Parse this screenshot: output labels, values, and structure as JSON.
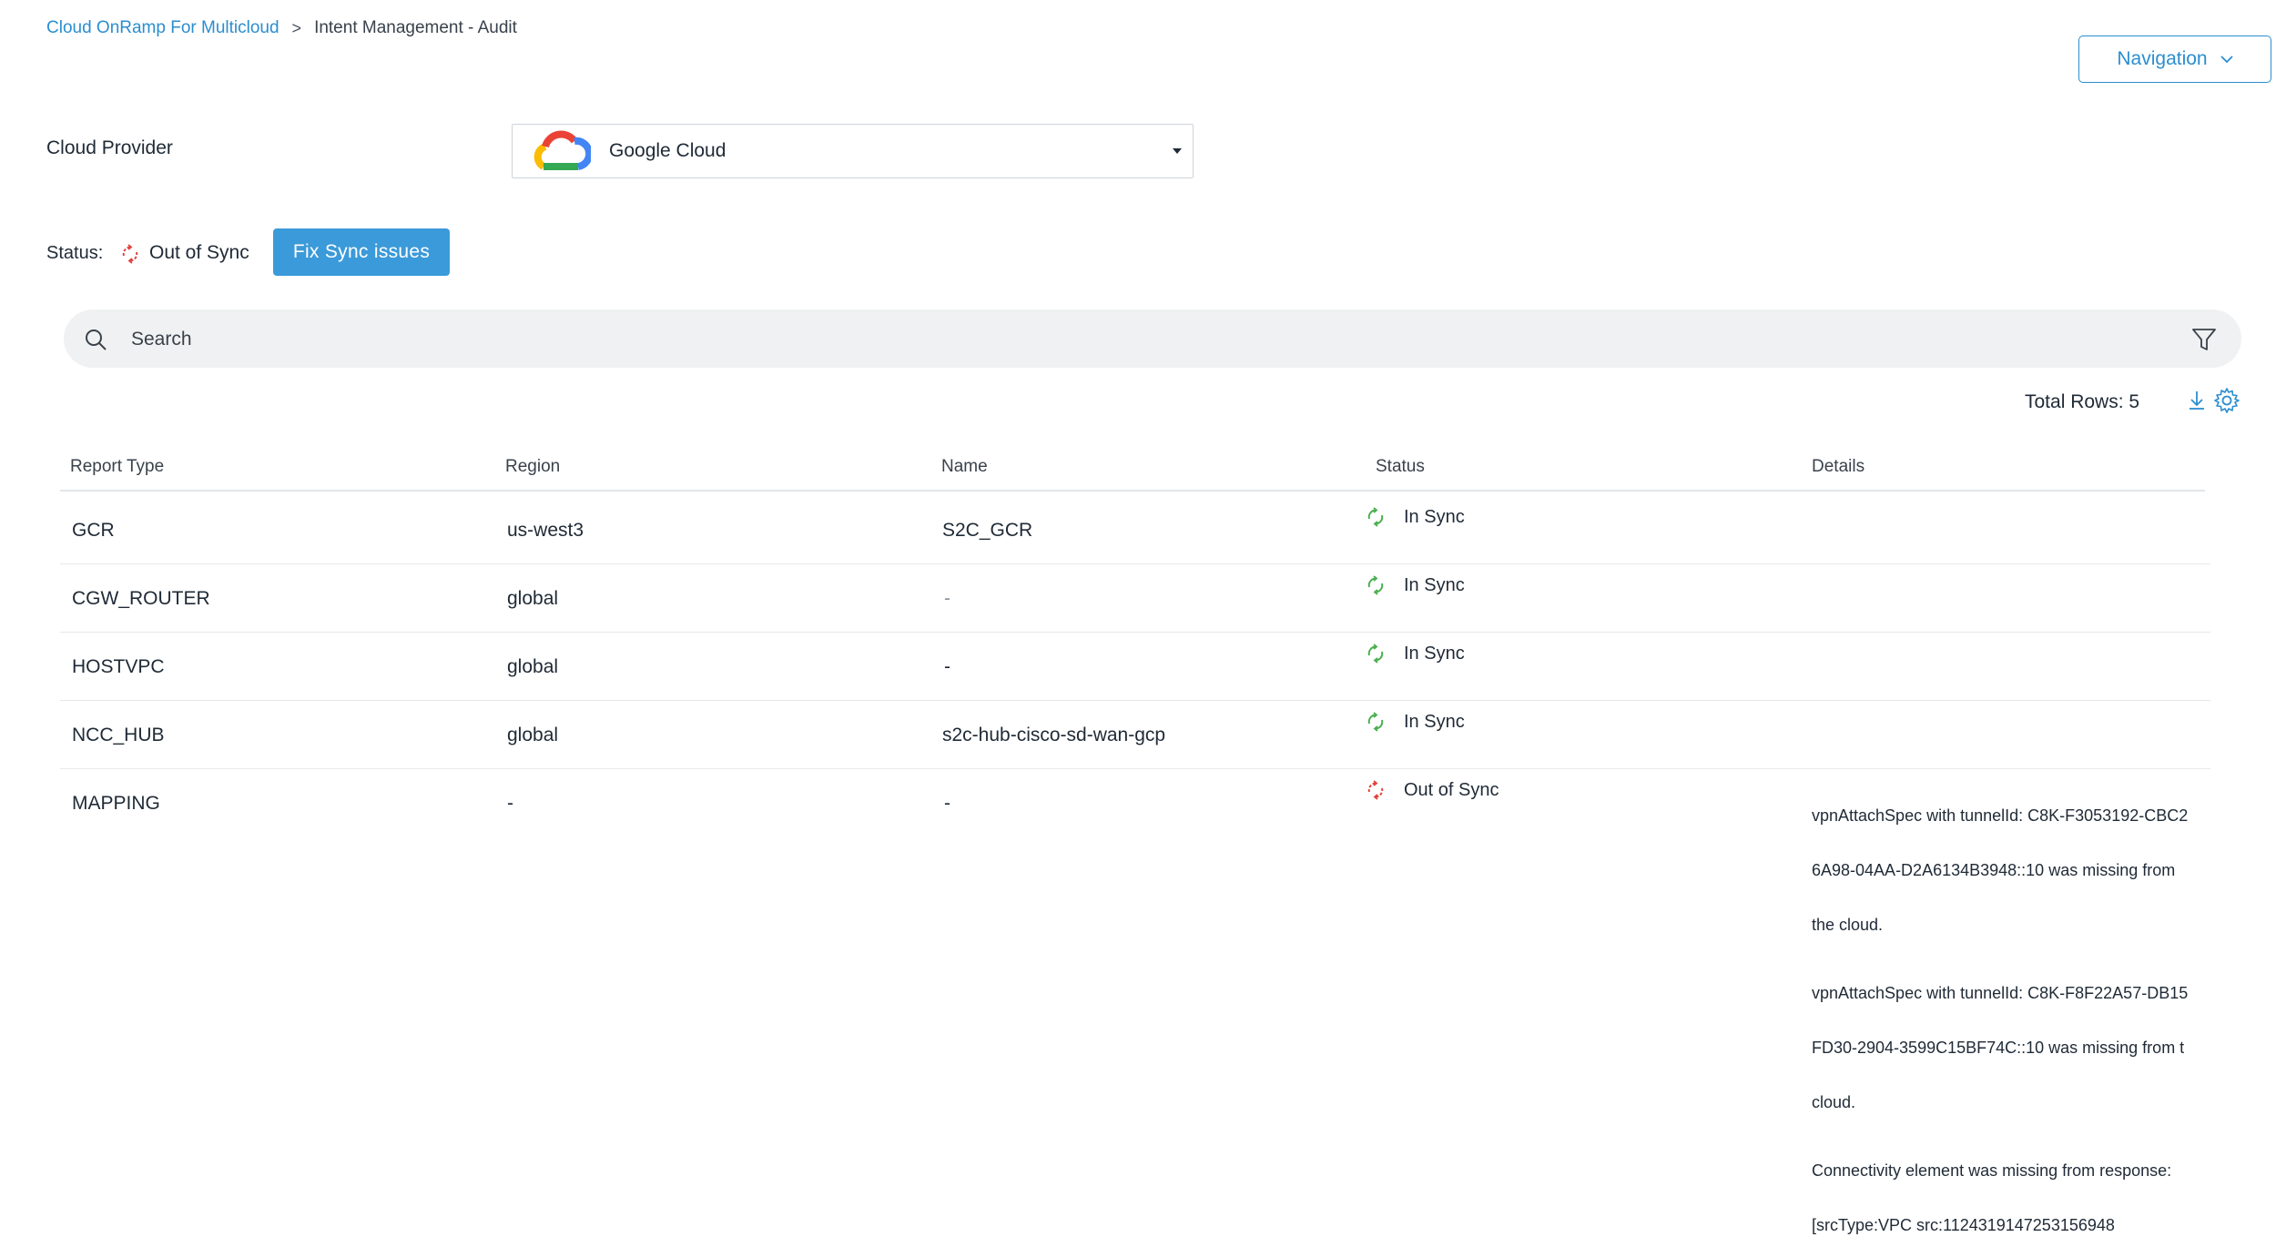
{
  "breadcrumb": {
    "parent": "Cloud OnRamp For Multicloud",
    "separator": ">",
    "current": "Intent Management - Audit"
  },
  "navigation_button": {
    "label": "Navigation"
  },
  "cloud_provider": {
    "label": "Cloud Provider",
    "selected": "Google Cloud"
  },
  "status": {
    "label": "Status:",
    "value": "Out of Sync",
    "fix_button": "Fix Sync issues"
  },
  "search": {
    "placeholder": "Search"
  },
  "table_meta": {
    "total_rows_label": "Total Rows: 5"
  },
  "table": {
    "columns": [
      "Report Type",
      "Region",
      "Name",
      "Status",
      "Details"
    ],
    "rows": [
      {
        "report_type": "GCR",
        "region": "us-west3",
        "name": "S2C_GCR",
        "status": "In Sync"
      },
      {
        "report_type": "CGW_ROUTER",
        "region": "global",
        "name": "-",
        "status": "In Sync"
      },
      {
        "report_type": "HOSTVPC",
        "region": "global",
        "name": "-",
        "status": "In Sync"
      },
      {
        "report_type": "NCC_HUB",
        "region": "global",
        "name": "s2c-hub-cisco-sd-wan-gcp",
        "status": "In Sync"
      },
      {
        "report_type": "MAPPING",
        "region": "-",
        "name": "-",
        "status": "Out of Sync",
        "details": [
          "vpnAttachSpec with tunnelId: C8K-F3053192-CBC2",
          "6A98-04AA-D2A6134B3948::10 was missing from",
          "the cloud.",
          "vpnAttachSpec with tunnelId: C8K-F8F22A57-DB15",
          "FD30-2904-3599C15BF74C::10 was missing from t",
          "cloud.",
          "Connectivity element was missing from response:",
          "[srcType:VPC src:1124319147253156948"
        ]
      }
    ]
  },
  "colors": {
    "accent": "#2b8ed0",
    "button_bg": "#3b9ad9",
    "in_sync": "#4caf50",
    "out_of_sync": "#e0443c"
  }
}
